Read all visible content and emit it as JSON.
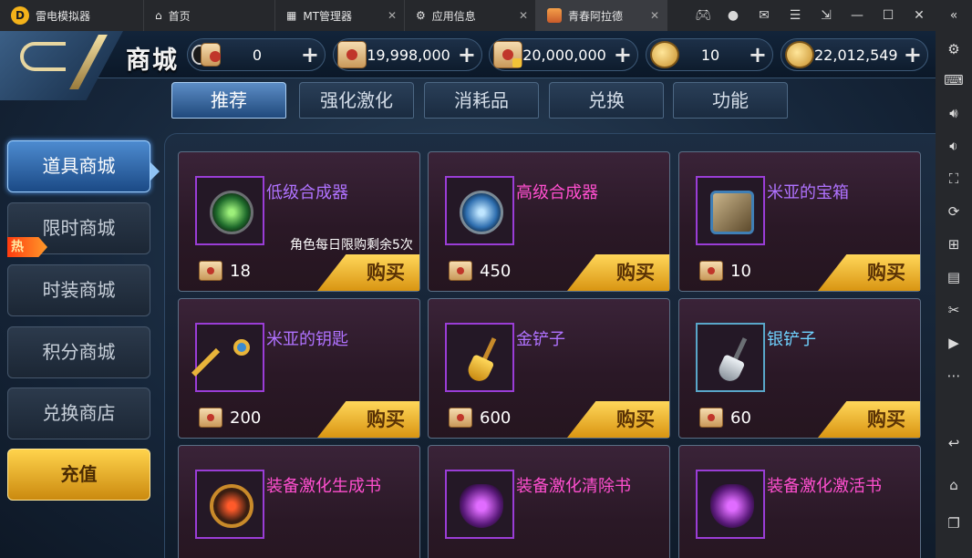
{
  "emulator": {
    "tabs": [
      {
        "label": "雷电模拟器"
      },
      {
        "label": "首页"
      },
      {
        "label": "MT管理器"
      },
      {
        "label": "应用信息"
      },
      {
        "label": "青春阿拉德"
      }
    ]
  },
  "header": {
    "title": "商城",
    "currencies": [
      {
        "icon": "mixed-currency-icon",
        "value": "0"
      },
      {
        "icon": "scroll-icon",
        "value": "19,998,000"
      },
      {
        "icon": "locked-scroll-icon",
        "value": "20,000,000"
      },
      {
        "icon": "gold-coin-icon",
        "value": "10"
      },
      {
        "icon": "gold-coins-icon",
        "value": "22,012,549"
      }
    ]
  },
  "category_tabs": [
    "推荐",
    "强化激化",
    "消耗品",
    "兑换",
    "功能"
  ],
  "active_tab": "推荐",
  "side_nav": {
    "items": [
      "道具商城",
      "限时商城",
      "时装商城",
      "积分商城",
      "兑换商店",
      "充值"
    ],
    "hot_badge": "热",
    "active": "道具商城"
  },
  "products": [
    {
      "name": "低级合成器",
      "price": "18",
      "limit": "角色每日限购剩余5次",
      "buy": "购买",
      "icon": "green-synthesizer-icon",
      "name_color": "#b072ff"
    },
    {
      "name": "高级合成器",
      "price": "450",
      "limit": "",
      "buy": "购买",
      "icon": "blue-synthesizer-icon",
      "name_color": "#ff4fcf"
    },
    {
      "name": "米亚的宝箱",
      "price": "10",
      "limit": "",
      "buy": "购买",
      "icon": "treasure-chest-icon",
      "name_color": "#b072ff"
    },
    {
      "name": "米亚的钥匙",
      "price": "200",
      "limit": "",
      "buy": "购买",
      "icon": "key-icon",
      "name_color": "#b072ff"
    },
    {
      "name": "金铲子",
      "price": "600",
      "limit": "",
      "buy": "购买",
      "icon": "gold-shovel-icon",
      "name_color": "#b072ff"
    },
    {
      "name": "银铲子",
      "price": "60",
      "limit": "",
      "buy": "购买",
      "icon": "silver-shovel-icon",
      "name_color": "#6fd2ff"
    },
    {
      "name": "装备激化生成书",
      "price": "",
      "limit": "",
      "buy": "",
      "icon": "amplify-book-icon",
      "name_color": "#ff4fcf"
    },
    {
      "name": "装备激化清除书",
      "price": "",
      "limit": "",
      "buy": "",
      "icon": "clear-book-icon",
      "name_color": "#ff4fcf"
    },
    {
      "name": "装备激化激活书",
      "price": "",
      "limit": "",
      "buy": "",
      "icon": "activate-book-icon",
      "name_color": "#ff4fcf"
    }
  ]
}
